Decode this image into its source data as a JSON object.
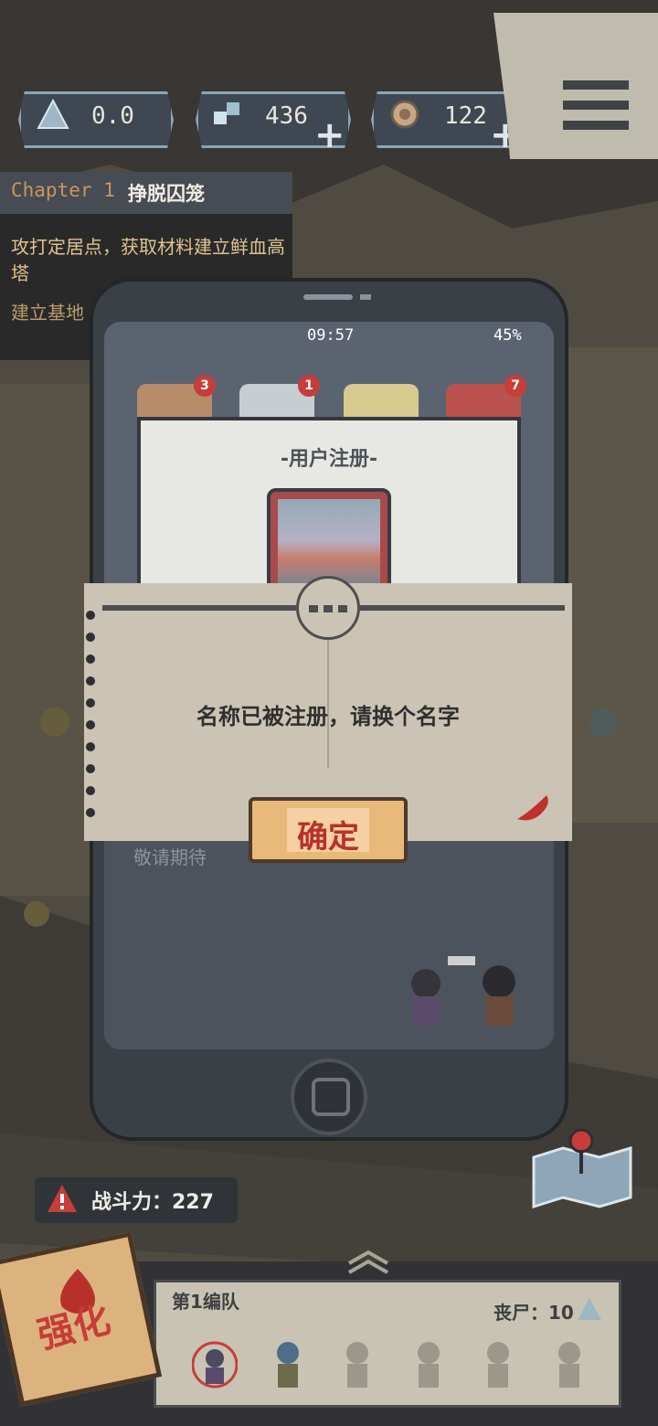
{
  "hud": {
    "resources": [
      {
        "name": "pyramid-icon",
        "value": "0.0"
      },
      {
        "name": "gem-icon",
        "value": "436"
      },
      {
        "name": "coin-icon",
        "value": "122"
      }
    ],
    "plus": "+",
    "menu_icon": "hamburger-menu-icon"
  },
  "chapter": {
    "label": "Chapter 1",
    "name": "挣脱囚笼",
    "quest": "攻打定居点，获取材料建立鲜血高塔",
    "sub": "建立基地"
  },
  "phone": {
    "time": "09:57",
    "battery": "45%",
    "apps": [
      {
        "badge": "3"
      },
      {
        "badge": "1"
      },
      {
        "badge": ""
      },
      {
        "badge": "7"
      }
    ],
    "register_title": "-用户注册-",
    "coming_soon": "敬请期待"
  },
  "dialog": {
    "message": "名称已被注册，请换个名字",
    "confirm": "确定"
  },
  "bottom": {
    "power_label": "战斗力：227",
    "team_name": "第1编队",
    "zombie_label": "丧尸：10",
    "strength_label": "强化"
  },
  "colors": {
    "accent_red": "#c63d39",
    "dialog_paper": "#cbc3b4",
    "button_gold": "#e9b97a"
  }
}
